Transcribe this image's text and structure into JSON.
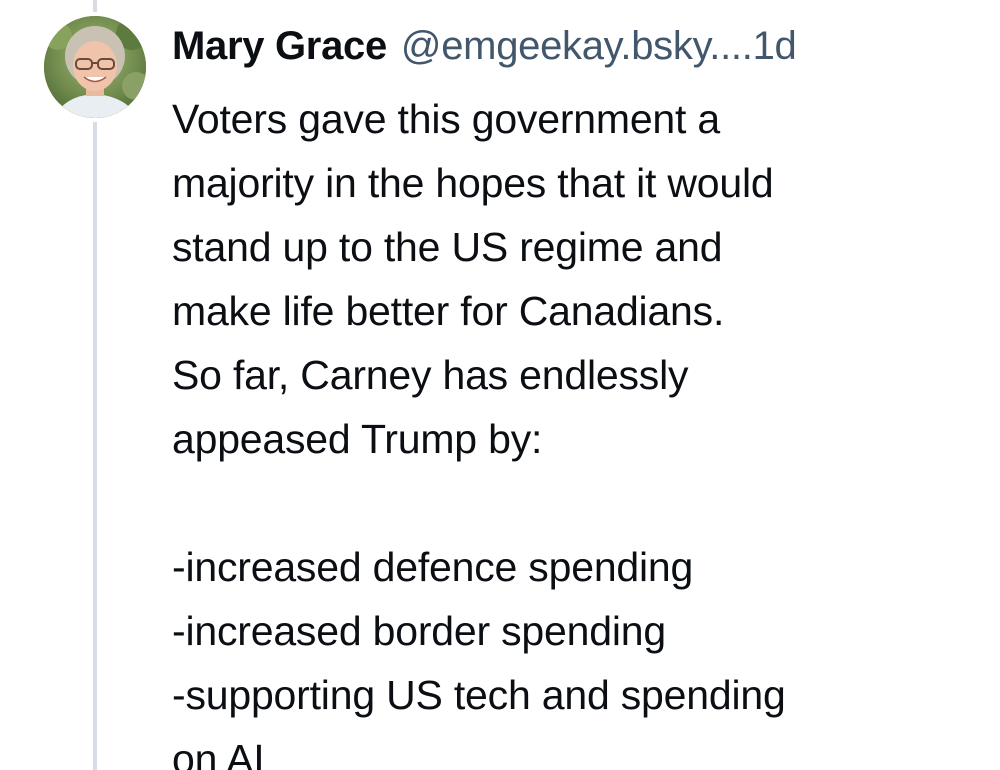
{
  "post": {
    "author": {
      "display_name": "Mary Grace",
      "handle": "@emgeekay.bsky....",
      "avatar_icon": "profile-photo-avatar"
    },
    "timestamp": "1d",
    "body": {
      "paragraph_1": [
        "Voters gave this government a",
        "majority in the hopes that it would",
        "stand up to the US regime and",
        "make life better for Canadians.",
        "So far, Carney has endlessly",
        "appeased Trump by:"
      ],
      "list_items": [
        "-increased defence spending",
        "-increased border spending",
        "-supporting US tech and spending",
        "on AI"
      ]
    }
  },
  "colors": {
    "background": "#ffffff",
    "text_primary": "#0b0f14",
    "text_secondary": "#42576c",
    "thread_line": "#d7dde5"
  }
}
